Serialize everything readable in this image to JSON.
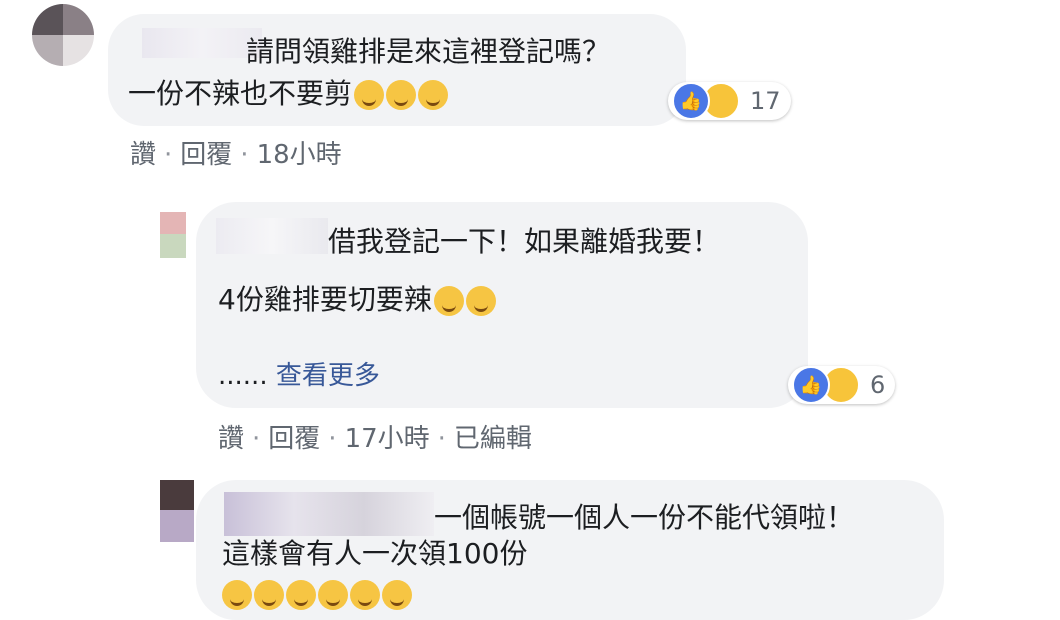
{
  "comments": [
    {
      "text_line1": "請問領雞排是來這裡登記嗎？",
      "text_line2": "一份不辣也不要剪",
      "reaction_count": "17",
      "actions": {
        "like": "讚",
        "reply": "回覆",
        "time": "18小時"
      }
    },
    {
      "text_line1": "借我登記一下！如果離婚我要！",
      "text_line2": "4份雞排要切要辣",
      "see_more_prefix": "......",
      "see_more": "查看更多",
      "reaction_count": "6",
      "actions": {
        "like": "讚",
        "reply": "回覆",
        "time": "17小時",
        "edited": "已編輯"
      }
    },
    {
      "text_line1": "一個帳號一個人一份不能代領啦！",
      "text_line2": "這樣會有人一次領100份"
    }
  ],
  "colors": {
    "bubble": "#f2f3f5",
    "like_blue": "#4a77e6",
    "haha_yellow": "#f7c43a",
    "meta_gray": "#606770",
    "link": "#385898"
  },
  "icons": [
    "like-icon",
    "haha-icon",
    "emoji-icon"
  ]
}
